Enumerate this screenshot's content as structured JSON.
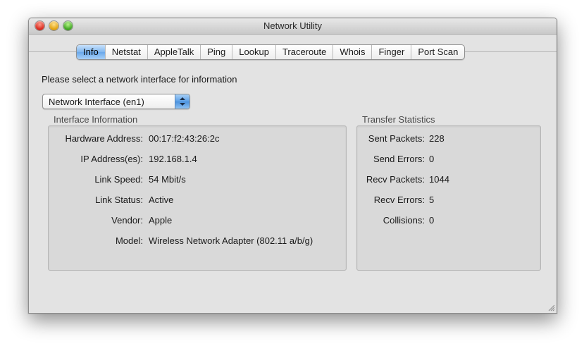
{
  "window": {
    "title": "Network Utility"
  },
  "tabs": [
    {
      "label": "Info",
      "active": true
    },
    {
      "label": "Netstat"
    },
    {
      "label": "AppleTalk"
    },
    {
      "label": "Ping"
    },
    {
      "label": "Lookup"
    },
    {
      "label": "Traceroute"
    },
    {
      "label": "Whois"
    },
    {
      "label": "Finger"
    },
    {
      "label": "Port Scan"
    }
  ],
  "prompt": "Please select a network interface for information",
  "interface_select": {
    "value": "Network Interface (en1)"
  },
  "interface_info": {
    "title": "Interface Information",
    "rows": [
      {
        "label": "Hardware Address:",
        "value": "00:17:f2:43:26:2c"
      },
      {
        "label": "IP Address(es):",
        "value": "192.168.1.4"
      },
      {
        "label": "Link Speed:",
        "value": "54 Mbit/s"
      },
      {
        "label": "Link Status:",
        "value": "Active"
      },
      {
        "label": "Vendor:",
        "value": "Apple"
      },
      {
        "label": "Model:",
        "value": "Wireless Network Adapter (802.11 a/b/g)"
      }
    ]
  },
  "transfer_stats": {
    "title": "Transfer Statistics",
    "rows": [
      {
        "label": "Sent Packets:",
        "value": "228"
      },
      {
        "label": "Send Errors:",
        "value": "0"
      },
      {
        "label": "Recv Packets:",
        "value": "1044"
      },
      {
        "label": "Recv Errors:",
        "value": "5"
      },
      {
        "label": "Collisions:",
        "value": "0"
      }
    ]
  },
  "colors": {
    "active_tab": "#7fb6ee",
    "window_bg": "#e3e3e3"
  },
  "icons": [
    "close-button",
    "minimize-button",
    "zoom-button",
    "popup-arrows-icon",
    "resize-grip-icon"
  ]
}
